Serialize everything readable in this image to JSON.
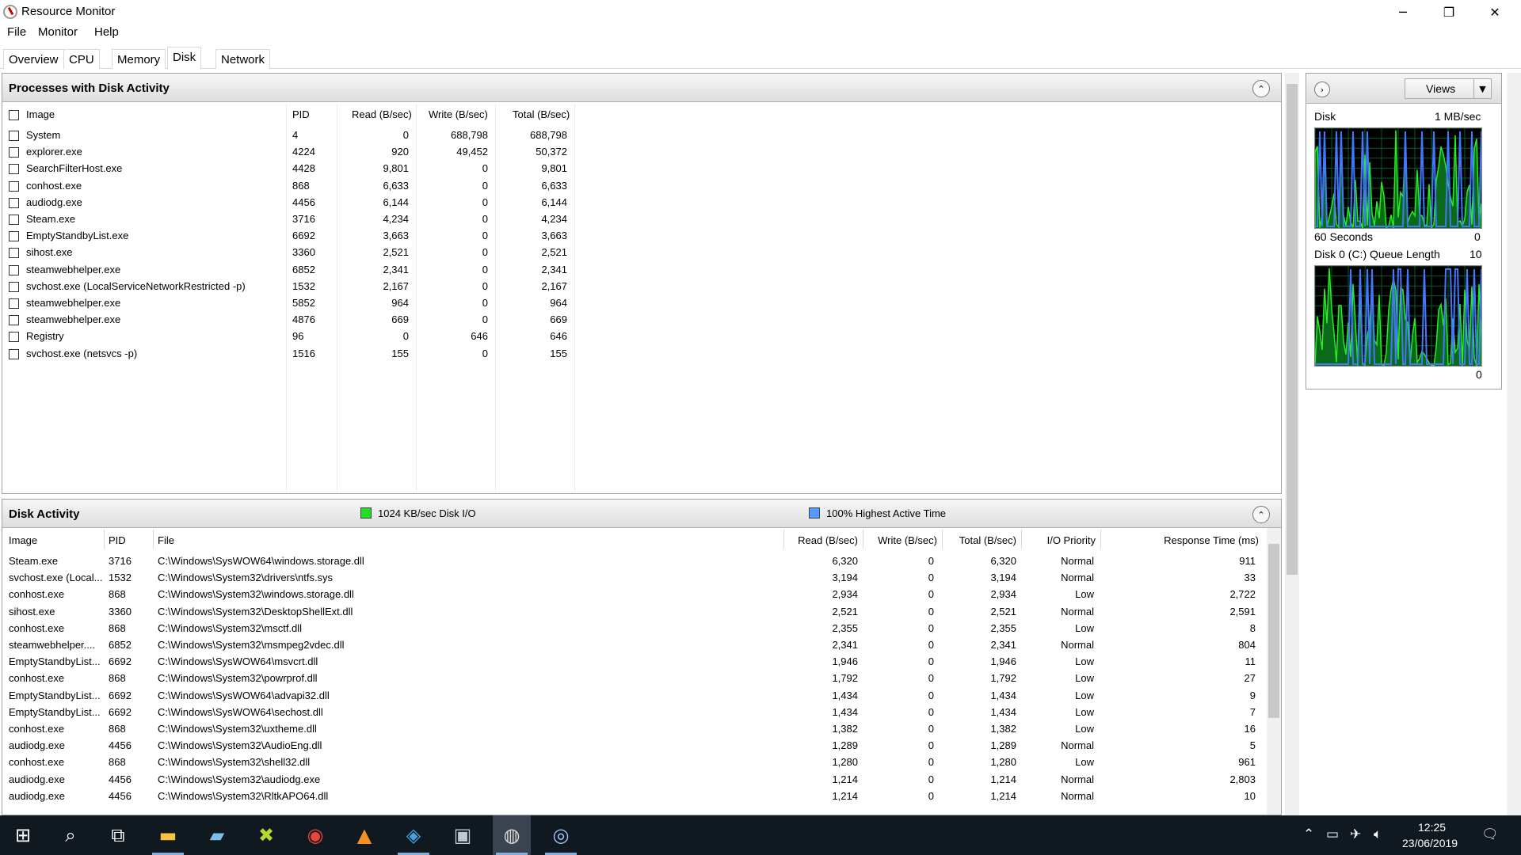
{
  "window": {
    "title": "Resource Monitor"
  },
  "window_controls": {
    "minimize": "─",
    "restore": "❐",
    "close": "✕"
  },
  "menu": [
    "File",
    "Monitor",
    "Help"
  ],
  "tabs": [
    "Overview",
    "CPU",
    "Memory",
    "Disk",
    "Network"
  ],
  "active_tab": "Disk",
  "processes_panel": {
    "title": "Processes with Disk Activity",
    "columns": [
      "Image",
      "PID",
      "Read (B/sec)",
      "Write (B/sec)",
      "Total (B/sec)"
    ],
    "rows": [
      [
        "System",
        "4",
        "0",
        "688,798",
        "688,798"
      ],
      [
        "explorer.exe",
        "4224",
        "920",
        "49,452",
        "50,372"
      ],
      [
        "SearchFilterHost.exe",
        "4428",
        "9,801",
        "0",
        "9,801"
      ],
      [
        "conhost.exe",
        "868",
        "6,633",
        "0",
        "6,633"
      ],
      [
        "audiodg.exe",
        "4456",
        "6,144",
        "0",
        "6,144"
      ],
      [
        "Steam.exe",
        "3716",
        "4,234",
        "0",
        "4,234"
      ],
      [
        "EmptyStandbyList.exe",
        "6692",
        "3,663",
        "0",
        "3,663"
      ],
      [
        "sihost.exe",
        "3360",
        "2,521",
        "0",
        "2,521"
      ],
      [
        "steamwebhelper.exe",
        "6852",
        "2,341",
        "0",
        "2,341"
      ],
      [
        "svchost.exe (LocalServiceNetworkRestricted -p)",
        "1532",
        "2,167",
        "0",
        "2,167"
      ],
      [
        "steamwebhelper.exe",
        "5852",
        "964",
        "0",
        "964"
      ],
      [
        "steamwebhelper.exe",
        "4876",
        "669",
        "0",
        "669"
      ],
      [
        "Registry",
        "96",
        "0",
        "646",
        "646"
      ],
      [
        "svchost.exe (netsvcs -p)",
        "1516",
        "155",
        "0",
        "155"
      ]
    ]
  },
  "disk_activity_panel": {
    "title": "Disk Activity",
    "legend_io": "1024 KB/sec Disk I/O",
    "legend_active": "100% Highest Active Time",
    "colors": {
      "io": "#22dd22",
      "active": "#5599ff"
    },
    "columns": [
      "Image",
      "PID",
      "File",
      "Read (B/sec)",
      "Write (B/sec)",
      "Total (B/sec)",
      "I/O Priority",
      "Response Time (ms)"
    ],
    "rows": [
      [
        "Steam.exe",
        "3716",
        "C:\\Windows\\SysWOW64\\windows.storage.dll",
        "6,320",
        "0",
        "6,320",
        "Normal",
        "911"
      ],
      [
        "svchost.exe (Local...",
        "1532",
        "C:\\Windows\\System32\\drivers\\ntfs.sys",
        "3,194",
        "0",
        "3,194",
        "Normal",
        "33"
      ],
      [
        "conhost.exe",
        "868",
        "C:\\Windows\\System32\\windows.storage.dll",
        "2,934",
        "0",
        "2,934",
        "Low",
        "2,722"
      ],
      [
        "sihost.exe",
        "3360",
        "C:\\Windows\\System32\\DesktopShellExt.dll",
        "2,521",
        "0",
        "2,521",
        "Normal",
        "2,591"
      ],
      [
        "conhost.exe",
        "868",
        "C:\\Windows\\System32\\msctf.dll",
        "2,355",
        "0",
        "2,355",
        "Low",
        "8"
      ],
      [
        "steamwebhelper....",
        "6852",
        "C:\\Windows\\System32\\msmpeg2vdec.dll",
        "2,341",
        "0",
        "2,341",
        "Normal",
        "804"
      ],
      [
        "EmptyStandbyList...",
        "6692",
        "C:\\Windows\\SysWOW64\\msvcrt.dll",
        "1,946",
        "0",
        "1,946",
        "Low",
        "11"
      ],
      [
        "conhost.exe",
        "868",
        "C:\\Windows\\System32\\powrprof.dll",
        "1,792",
        "0",
        "1,792",
        "Low",
        "27"
      ],
      [
        "EmptyStandbyList...",
        "6692",
        "C:\\Windows\\SysWOW64\\advapi32.dll",
        "1,434",
        "0",
        "1,434",
        "Low",
        "9"
      ],
      [
        "EmptyStandbyList...",
        "6692",
        "C:\\Windows\\SysWOW64\\sechost.dll",
        "1,434",
        "0",
        "1,434",
        "Low",
        "7"
      ],
      [
        "conhost.exe",
        "868",
        "C:\\Windows\\System32\\uxtheme.dll",
        "1,382",
        "0",
        "1,382",
        "Low",
        "16"
      ],
      [
        "audiodg.exe",
        "4456",
        "C:\\Windows\\System32\\AudioEng.dll",
        "1,289",
        "0",
        "1,289",
        "Normal",
        "5"
      ],
      [
        "conhost.exe",
        "868",
        "C:\\Windows\\System32\\shell32.dll",
        "1,280",
        "0",
        "1,280",
        "Low",
        "961"
      ],
      [
        "audiodg.exe",
        "4456",
        "C:\\Windows\\System32\\audiodg.exe",
        "1,214",
        "0",
        "1,214",
        "Normal",
        "2,803"
      ],
      [
        "audiodg.exe",
        "4456",
        "C:\\Windows\\System32\\RltkAPO64.dll",
        "1,214",
        "0",
        "1,214",
        "Normal",
        "10"
      ]
    ]
  },
  "right_pane": {
    "views_label": "Views",
    "graph1": {
      "title": "Disk",
      "scale": "1 MB/sec",
      "time": "60 Seconds",
      "min": "0"
    },
    "graph2": {
      "title": "Disk 0 (C:) Queue Length",
      "scale": "10",
      "min": "0"
    }
  },
  "taskbar": {
    "icons": [
      "windows-start-icon",
      "search-icon",
      "task-view-icon",
      "file-explorer-icon",
      "notepad-icon",
      "app-icon",
      "chrome-icon",
      "vlc-icon",
      "app-icon",
      "app-icon",
      "resource-monitor-icon",
      "steam-icon"
    ],
    "time": "12:25",
    "date": "23/06/2019"
  }
}
